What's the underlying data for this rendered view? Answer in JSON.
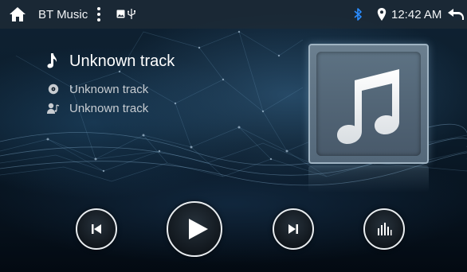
{
  "status_bar": {
    "app_title": "BT Music",
    "time": "12:42 AM",
    "icons": [
      "home-icon",
      "menu-icon",
      "gallery-icon",
      "usb-icon",
      "bluetooth-icon",
      "location-icon",
      "back-icon"
    ]
  },
  "track": {
    "title": "Unknown track",
    "album": "Unknown track",
    "artist": "Unknown track",
    "icons": [
      "music-note-icon",
      "disc-icon",
      "artist-icon"
    ]
  },
  "album_art": {
    "icon": "music-note-icon"
  },
  "controls": {
    "buttons": [
      "previous-button",
      "play-button",
      "next-button",
      "equalizer-button"
    ]
  },
  "colors": {
    "bluetooth": "#2a8cff",
    "text_primary": "#ffffff",
    "text_secondary": "#c7ccd1",
    "status_bar": "#1e2a36"
  }
}
